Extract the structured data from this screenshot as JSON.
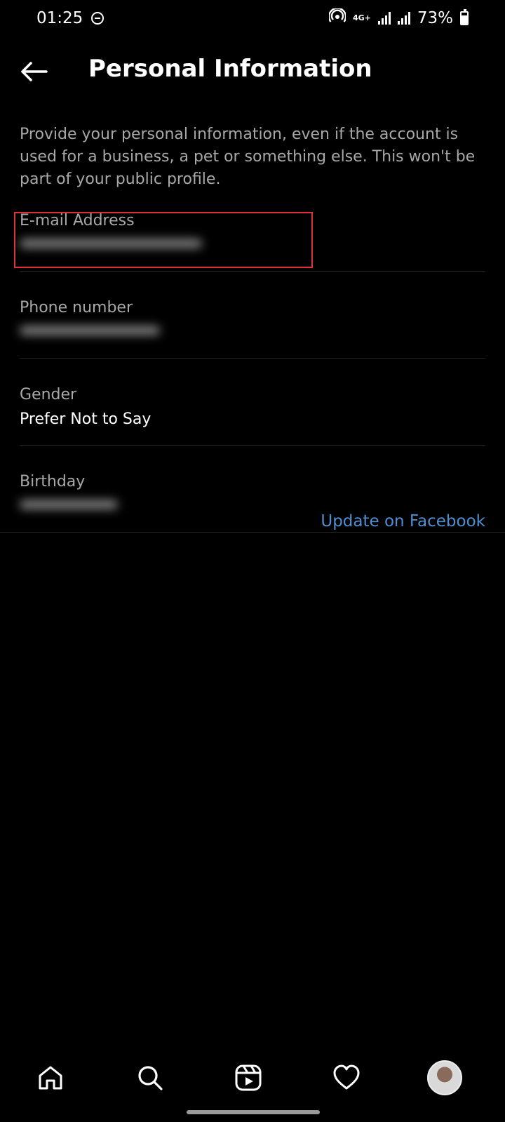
{
  "status_bar": {
    "time": "01:25",
    "network": "4G+",
    "battery": "73%",
    "battery_level": 0.73,
    "icons": [
      "do-not-disturb-icon",
      "hotspot-icon",
      "signal-icon",
      "signal-icon",
      "battery-icon"
    ]
  },
  "header": {
    "title": "Personal Information",
    "back_icon": "arrow-left-icon"
  },
  "description": "Provide your personal information, even if the account is used for a business, a pet or something else. This won't be part of your public profile.",
  "fields": {
    "email": {
      "label": "E-mail Address",
      "value": ""
    },
    "phone": {
      "label": "Phone number",
      "value": ""
    },
    "gender": {
      "label": "Gender",
      "value": "Prefer Not to Say"
    },
    "birthday": {
      "label": "Birthday",
      "value": ""
    }
  },
  "birthday_link": "Update on Facebook",
  "highlight_color": "#e0303a",
  "link_color": "#4f8ed1",
  "bottom_nav": {
    "items": [
      "home-icon",
      "search-icon",
      "reels-icon",
      "heart-icon",
      "profile-avatar"
    ]
  }
}
